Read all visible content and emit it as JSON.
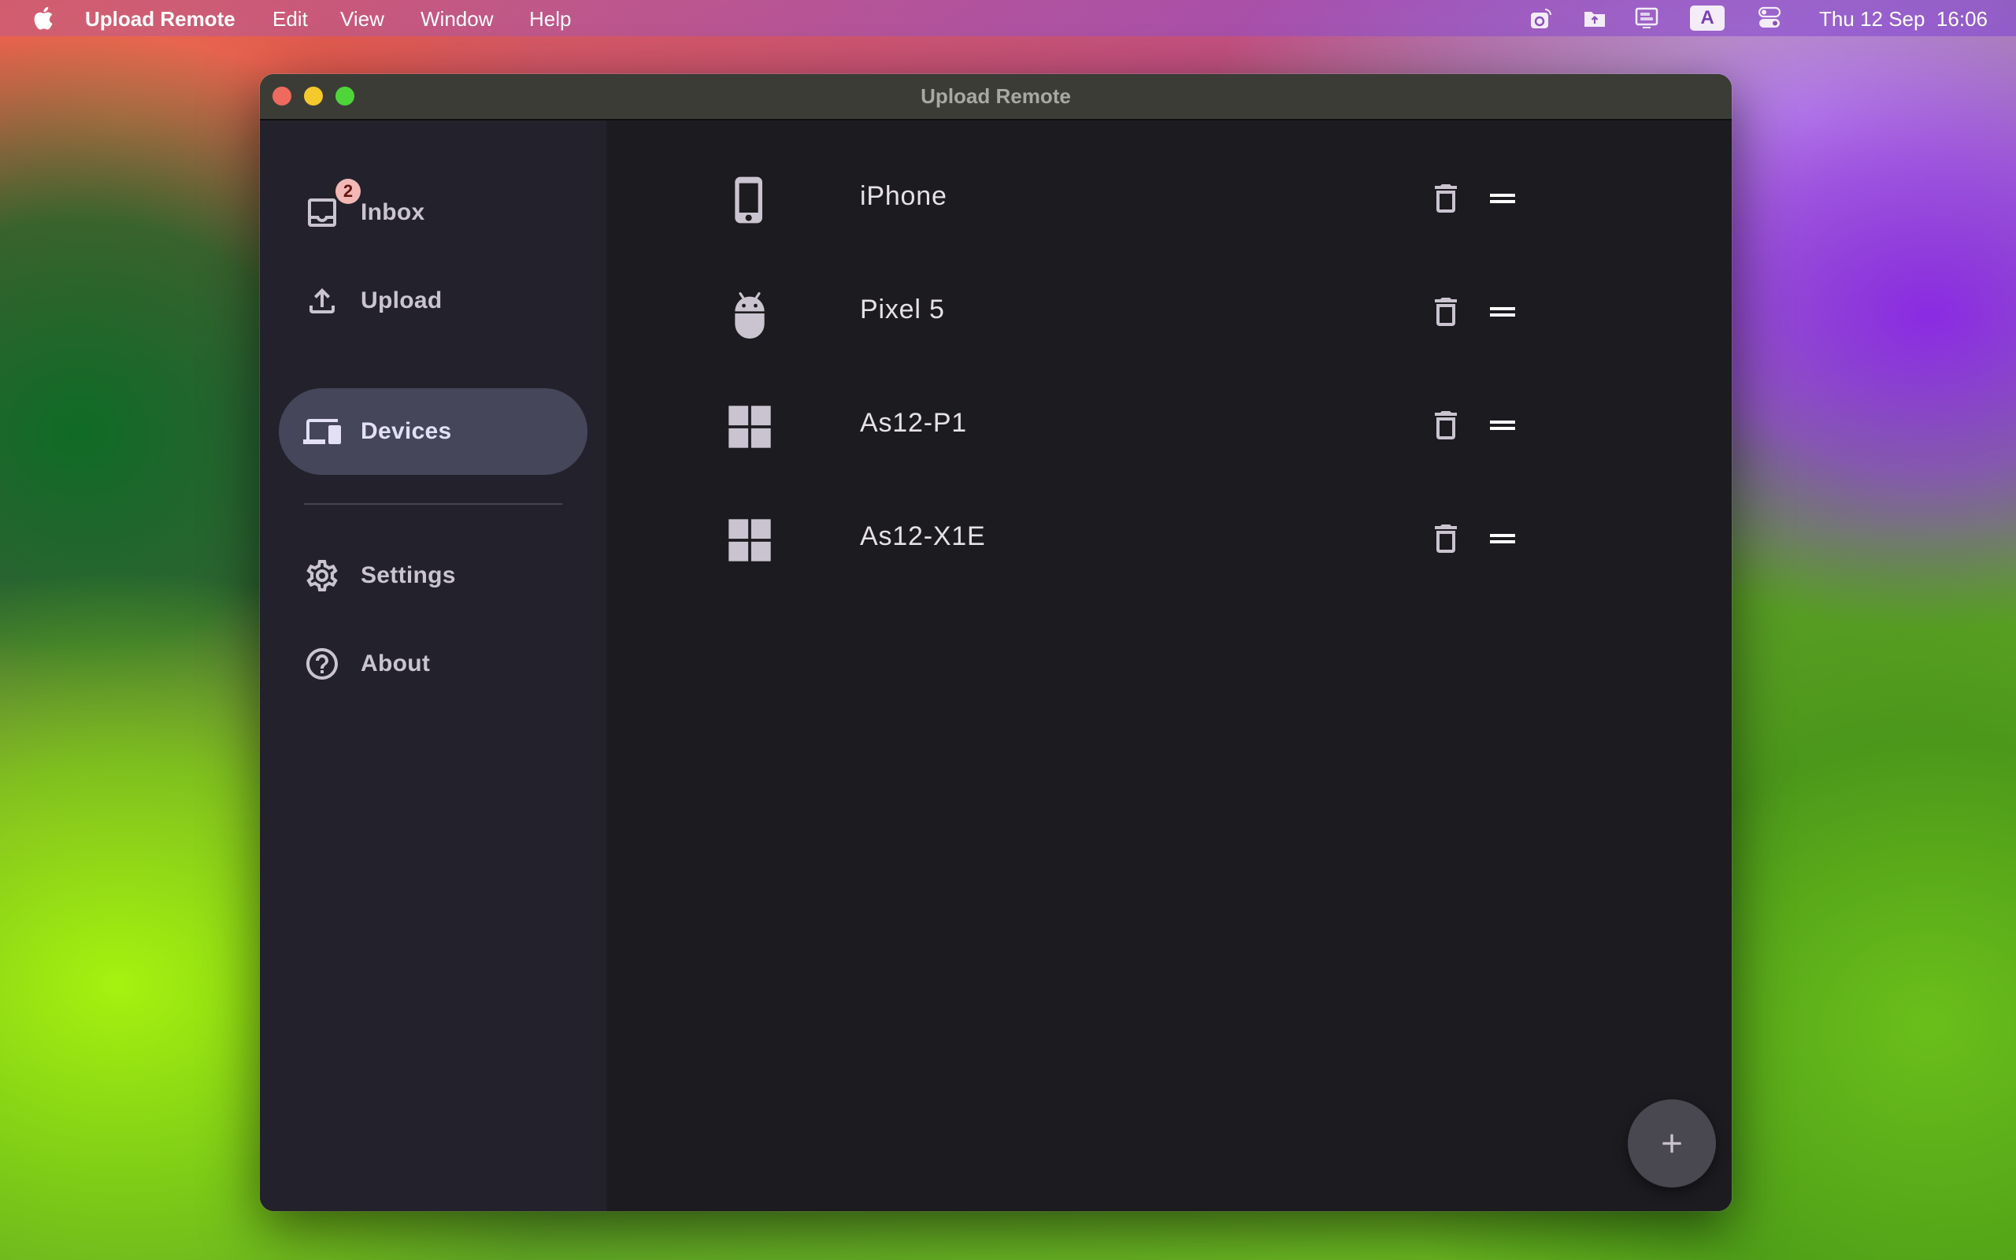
{
  "menubar": {
    "app_name": "Upload Remote",
    "menus": [
      "Edit",
      "View",
      "Window",
      "Help"
    ],
    "status_icons": [
      "camera-sync-icon",
      "folder-upload-icon",
      "screen-mirror-icon",
      "keyboard-input-A-icon",
      "control-center-icon"
    ],
    "input_source_letter": "A",
    "clock": "Thu 12 Sep  16:06"
  },
  "window": {
    "title": "Upload Remote"
  },
  "sidebar": {
    "items": [
      {
        "label": "Inbox",
        "icon": "inbox-icon",
        "badge": "2",
        "active": false
      },
      {
        "label": "Upload",
        "icon": "upload-icon",
        "active": false
      },
      {
        "label": "Devices",
        "icon": "devices-icon",
        "active": true
      },
      {
        "label": "Settings",
        "icon": "gear-icon",
        "active": false
      },
      {
        "label": "About",
        "icon": "help-circle-icon",
        "active": false
      }
    ]
  },
  "devices": [
    {
      "name": "iPhone",
      "type": "ios",
      "icon": "smartphone-icon"
    },
    {
      "name": "Pixel 5",
      "type": "android",
      "icon": "android-icon"
    },
    {
      "name": "As12-P1",
      "type": "windows",
      "icon": "windows-icon"
    },
    {
      "name": "As12-X1E",
      "type": "windows",
      "icon": "windows-icon"
    }
  ],
  "colors": {
    "accent_pill": "#45465a",
    "badge_bg": "#f2b8b5",
    "badge_text": "#601410",
    "icon": "#cac4d0",
    "fab": "#49474f"
  },
  "fab": {
    "icon": "plus-icon",
    "action": "add-device"
  }
}
